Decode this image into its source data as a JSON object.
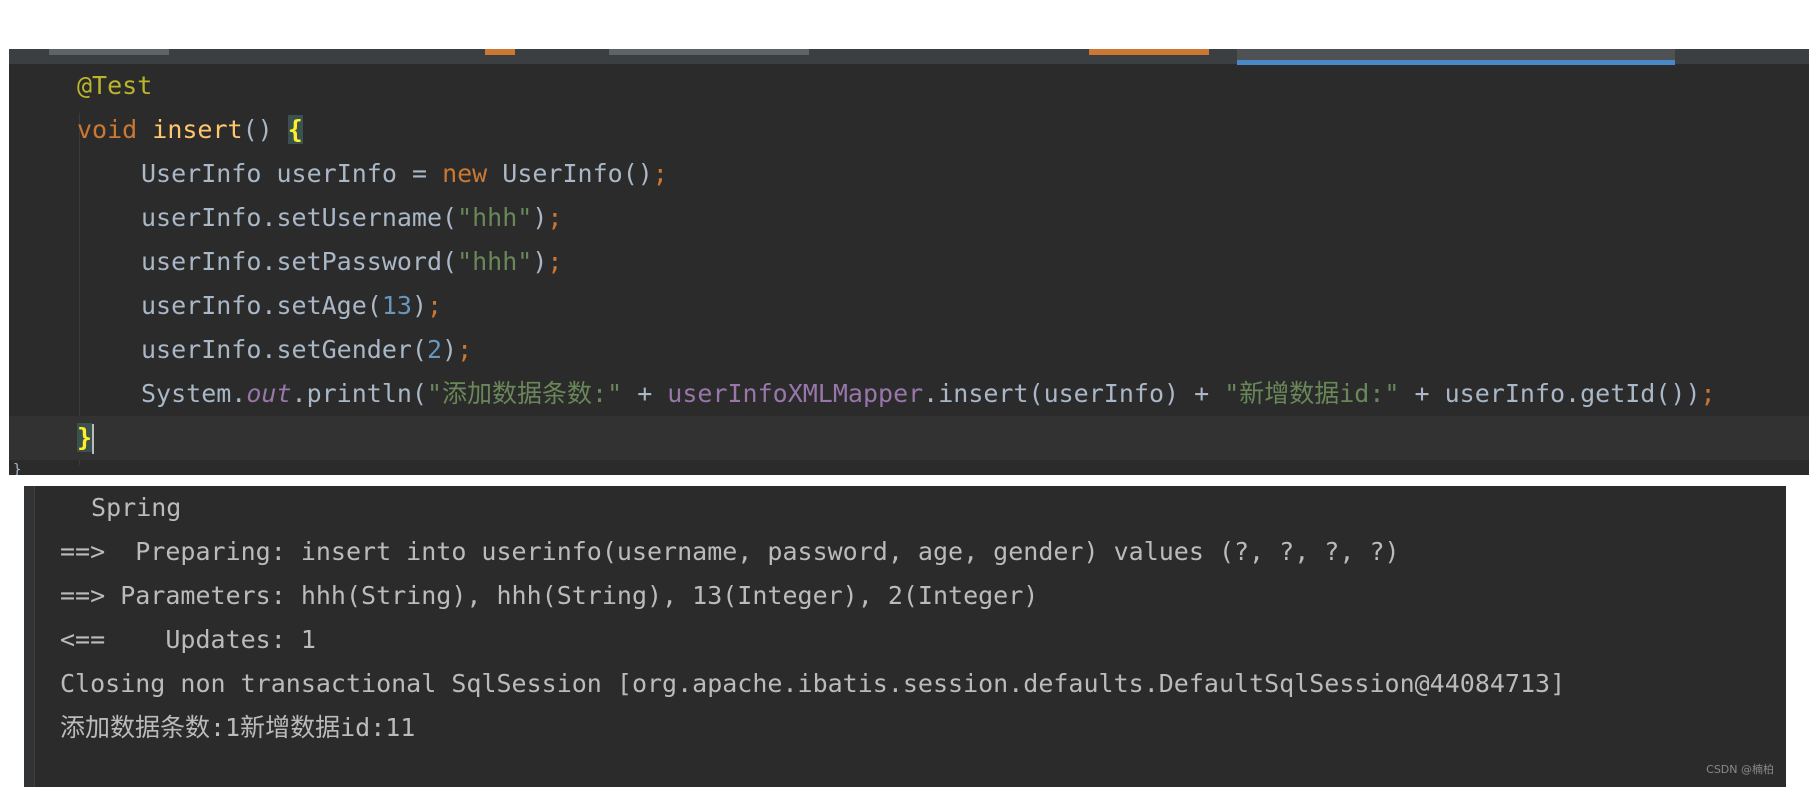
{
  "editor": {
    "line_annotation": "@Test",
    "line_signature": {
      "keyword": "void",
      "method": "insert",
      "parens": "()",
      "brace": "{"
    },
    "line_new": {
      "type": "UserInfo",
      "var": "userInfo",
      "eq": " = ",
      "keyword": "new",
      "ctor": "UserInfo()",
      "semi": ";"
    },
    "line_set_username": {
      "call": "userInfo.setUsername(",
      "arg": "\"hhh\"",
      "close": ")",
      "semi": ";"
    },
    "line_set_password": {
      "call": "userInfo.setPassword(",
      "arg": "\"hhh\"",
      "close": ")",
      "semi": ";"
    },
    "line_set_age": {
      "call": "userInfo.setAge(",
      "arg": "13",
      "close": ")",
      "semi": ";"
    },
    "line_set_gender": {
      "call": "userInfo.setGender(",
      "arg": "2",
      "close": ")",
      "semi": ";"
    },
    "line_println": {
      "system": "System.",
      "out": "out",
      "println": ".println(",
      "str1": "\"添加数据条数:\"",
      "plus1": " + ",
      "mapper": "userInfoXMLMapper",
      "insert_call": ".insert(userInfo)",
      "plus2": " + ",
      "str2": "\"新增数据id:\"",
      "plus3": " + ",
      "get_id": "userInfo.getId())",
      "semi": ";"
    },
    "line_close": {
      "brace": "}"
    },
    "trailing_brace": "}"
  },
  "console": {
    "lines": [
      " Spring",
      "==>  Preparing: insert into userinfo(username, password, age, gender) values (?, ?, ?, ?)",
      "==> Parameters: hhh(String), hhh(String), 13(Integer), 2(Integer)",
      "<==    Updates: 1",
      "Closing non transactional SqlSession [org.apache.ibatis.session.defaults.DefaultSqlSession@44084713]",
      "添加数据条数:1新增数据id:11"
    ]
  },
  "watermark": "CSDN @楠柏",
  "colors": {
    "editor_bg": "#2b2b2b",
    "keyword": "#cc7832",
    "string": "#6a8759",
    "number": "#6897bb",
    "annotation": "#bbb529",
    "method_decl": "#ffc66d",
    "field": "#9876aa",
    "default_text": "#a9b7c6",
    "active_tab_underline": "#4a88c7"
  }
}
